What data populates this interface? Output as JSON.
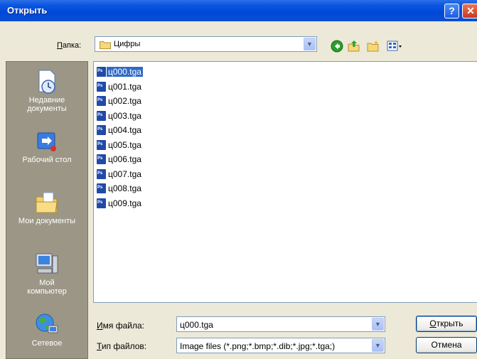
{
  "window": {
    "title": "Открыть"
  },
  "lookin": {
    "label_u": "П",
    "label_rest": "апка:",
    "value": "Цифры"
  },
  "places": [
    {
      "name": "recent",
      "label": "Недавние документы"
    },
    {
      "name": "desktop",
      "label": "Рабочий стол"
    },
    {
      "name": "mydocs",
      "label": "Мои документы"
    },
    {
      "name": "mycomputer",
      "label": "Мой компьютер"
    },
    {
      "name": "network",
      "label": "Сетевое"
    }
  ],
  "files": [
    "ц000.tga",
    "ц001.tga",
    "ц002.tga",
    "ц003.tga",
    "ц004.tga",
    "ц005.tga",
    "ц006.tga",
    "ц007.tga",
    "ц008.tga",
    "ц009.tga"
  ],
  "selected_file": "ц000.tga",
  "file_icon_label": "Ps",
  "filename": {
    "label_u": "И",
    "label_rest": "мя файла:",
    "value": "ц000.tga"
  },
  "filetype": {
    "label_u": "Т",
    "label_rest": "ип файлов:",
    "value": "Image files (*.png;*.bmp;*.dib;*.jpg;*.tga;)"
  },
  "buttons": {
    "open_u": "О",
    "open_rest": "ткрыть",
    "cancel": "Отмена"
  },
  "icons": {
    "help": "?",
    "close": "✕",
    "dropdown": "▼"
  },
  "colors": {
    "titlebar": "#0a56e0",
    "selection": "#316ac5",
    "places_bg": "#9b9686"
  }
}
